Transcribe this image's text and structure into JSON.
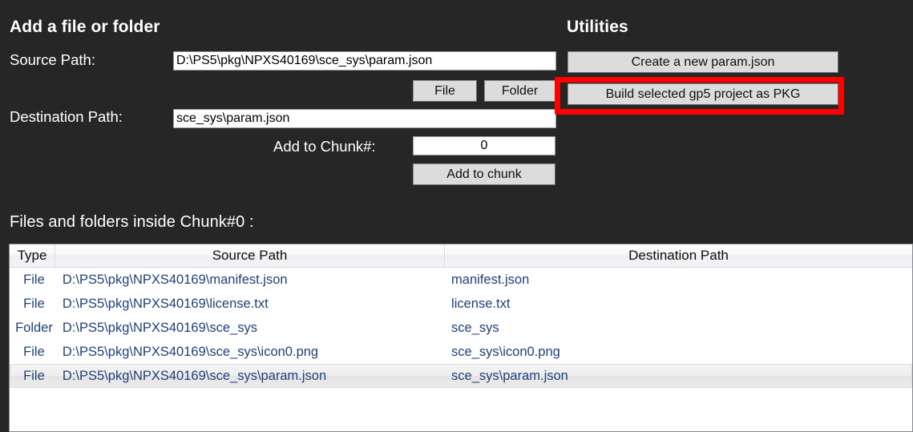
{
  "left_panel": {
    "title": "Add a file or folder",
    "source_path_label": "Source Path:",
    "source_path_value": "D:\\PS5\\pkg\\NPXS40169\\sce_sys\\param.json",
    "file_button": "File",
    "folder_button": "Folder",
    "destination_path_label": "Destination Path:",
    "destination_path_value": "sce_sys\\param.json",
    "chunk_label": "Add to Chunk#:",
    "chunk_value": "0",
    "add_to_chunk_button": "Add to chunk"
  },
  "utilities": {
    "title": "Utilities",
    "create_param_button": "Create a new param.json",
    "build_pkg_button": "Build selected gp5 project as PKG",
    "highlight_color": "#fe0000"
  },
  "files_section": {
    "title": "Files and folders inside Chunk#0 :",
    "columns": [
      {
        "label": "Type"
      },
      {
        "label": "Source Path"
      },
      {
        "label": "Destination Path"
      }
    ],
    "rows": [
      {
        "type": "File",
        "source": "D:\\PS5\\pkg\\NPXS40169\\manifest.json",
        "destination": "manifest.json",
        "selected": false
      },
      {
        "type": "File",
        "source": "D:\\PS5\\pkg\\NPXS40169\\license.txt",
        "destination": "license.txt",
        "selected": false
      },
      {
        "type": "Folder",
        "source": "D:\\PS5\\pkg\\NPXS40169\\sce_sys",
        "destination": "sce_sys",
        "selected": false
      },
      {
        "type": "File",
        "source": "D:\\PS5\\pkg\\NPXS40169\\sce_sys\\icon0.png",
        "destination": "sce_sys\\icon0.png",
        "selected": false
      },
      {
        "type": "File",
        "source": "D:\\PS5\\pkg\\NPXS40169\\sce_sys\\param.json",
        "destination": "sce_sys\\param.json",
        "selected": true
      }
    ]
  },
  "theme": {
    "background": "#262626",
    "text": "#ffffff",
    "row_text": "#1f3f7a",
    "button_face": "#dcdcdc"
  }
}
